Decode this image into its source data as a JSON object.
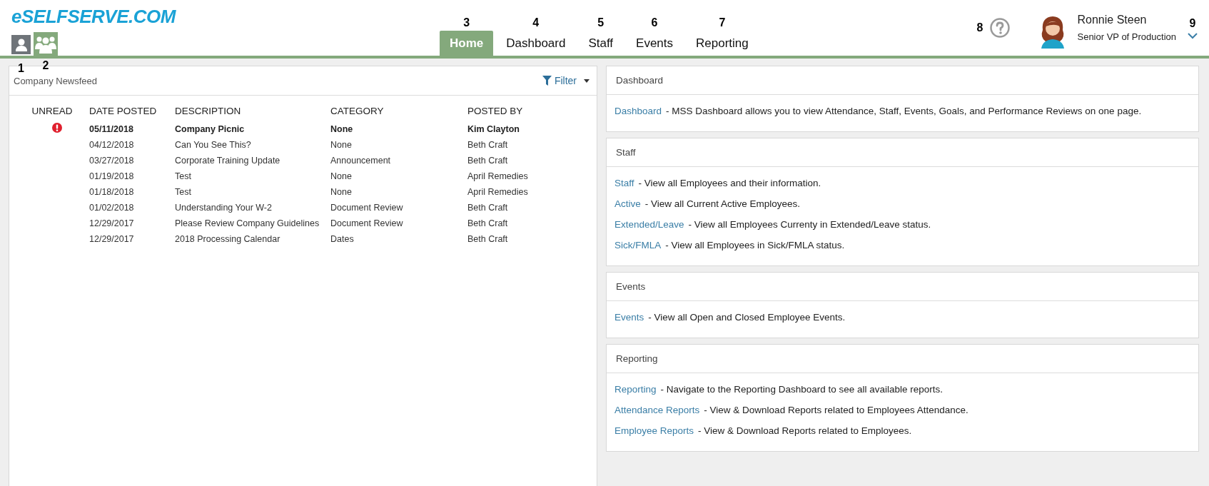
{
  "logo": "eSELFSERVE.COM",
  "view_switch": [
    {
      "kind": "single",
      "selected": false,
      "callout": "1"
    },
    {
      "kind": "group",
      "selected": true,
      "callout": "2"
    }
  ],
  "nav_tabs": [
    {
      "label": "Home",
      "selected": true,
      "callout": "3"
    },
    {
      "label": "Dashboard",
      "selected": false,
      "callout": "4"
    },
    {
      "label": "Staff",
      "selected": false,
      "callout": "5"
    },
    {
      "label": "Events",
      "selected": false,
      "callout": "6"
    },
    {
      "label": "Reporting",
      "selected": false,
      "callout": "7"
    }
  ],
  "help": {
    "callout": "8"
  },
  "user": {
    "name": "Ronnie Steen",
    "role": "Senior VP of Production",
    "callout": "9"
  },
  "newsfeed": {
    "title": "Company Newsfeed",
    "filter_label": "Filter",
    "columns": [
      "UNREAD",
      "DATE POSTED",
      "DESCRIPTION",
      "CATEGORY",
      "POSTED BY"
    ],
    "rows": [
      {
        "unread": true,
        "date": "05/11/2018",
        "description": "Company Picnic",
        "category": "None",
        "posted_by": "Kim Clayton"
      },
      {
        "unread": false,
        "date": "04/12/2018",
        "description": "Can You See This?",
        "category": "None",
        "posted_by": "Beth Craft"
      },
      {
        "unread": false,
        "date": "03/27/2018",
        "description": "Corporate Training Update",
        "category": "Announcement",
        "posted_by": "Beth Craft"
      },
      {
        "unread": false,
        "date": "01/19/2018",
        "description": "Test",
        "category": "None",
        "posted_by": "April Remedies"
      },
      {
        "unread": false,
        "date": "01/18/2018",
        "description": "Test",
        "category": "None",
        "posted_by": "April Remedies"
      },
      {
        "unread": false,
        "date": "01/02/2018",
        "description": "Understanding Your W-2",
        "category": "Document Review",
        "posted_by": "Beth Craft"
      },
      {
        "unread": false,
        "date": "12/29/2017",
        "description": "Please Review Company Guidelines",
        "category": "Document Review",
        "posted_by": "Beth Craft"
      },
      {
        "unread": false,
        "date": "12/29/2017",
        "description": "2018 Processing Calendar",
        "category": "Dates",
        "posted_by": "Beth Craft"
      }
    ]
  },
  "panels": [
    {
      "title": "Dashboard",
      "links": [
        {
          "link": "Dashboard",
          "text": "- MSS Dashboard allows you to view Attendance, Staff, Events, Goals, and Performance Reviews on one page."
        }
      ]
    },
    {
      "title": "Staff",
      "links": [
        {
          "link": "Staff",
          "text": "- View all Employees and their information."
        },
        {
          "link": "Active",
          "text": "- View all Current Active Employees."
        },
        {
          "link": "Extended/Leave",
          "text": "- View all Employees Currenty in Extended/Leave status."
        },
        {
          "link": "Sick/FMLA",
          "text": "- View all Employees in Sick/FMLA status."
        }
      ]
    },
    {
      "title": "Events",
      "links": [
        {
          "link": "Events",
          "text": "- View all Open and Closed Employee Events."
        }
      ]
    },
    {
      "title": "Reporting",
      "links": [
        {
          "link": "Reporting",
          "text": "- Navigate to the Reporting Dashboard to see all available reports."
        },
        {
          "link": "Attendance Reports",
          "text": "- View & Download Reports related to Employees Attendance."
        },
        {
          "link": "Employee Reports",
          "text": "- View & Download Reports related to Employees."
        }
      ]
    }
  ]
}
